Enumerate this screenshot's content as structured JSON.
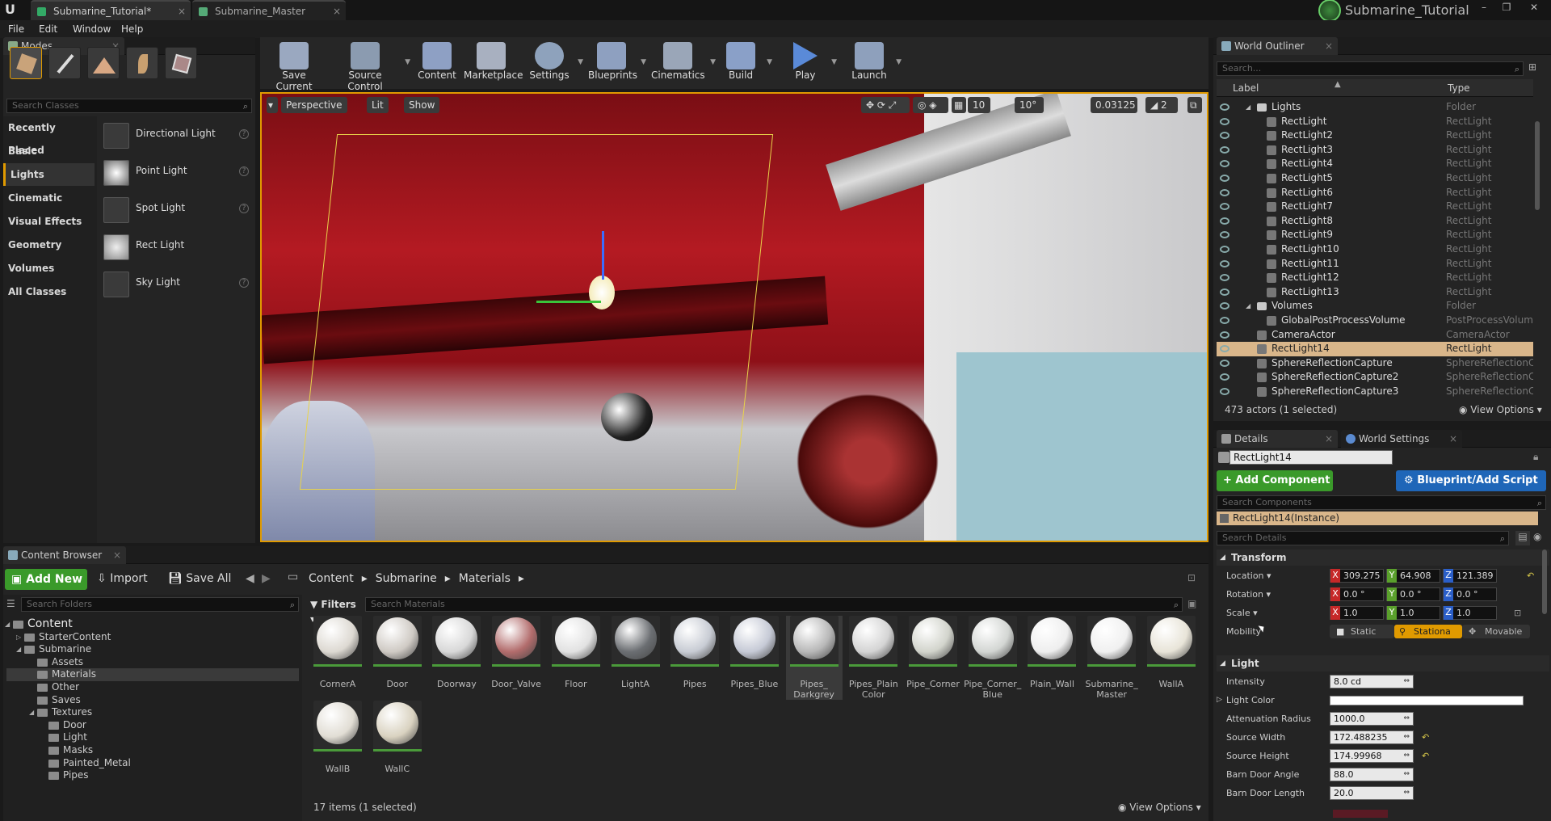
{
  "title_bar": {
    "tabs": [
      "Submarine_Tutorial*",
      "Submarine_Master"
    ],
    "project_name": "Submarine_Tutorial"
  },
  "menu": [
    "File",
    "Edit",
    "Window",
    "Help"
  ],
  "modes": {
    "tab_label": "Modes",
    "search_placeholder": "Search Classes",
    "categories": [
      "Recently Placed",
      "Basic",
      "Lights",
      "Cinematic",
      "Visual Effects",
      "Geometry",
      "Volumes",
      "All Classes"
    ],
    "selected_category": "Lights",
    "items": [
      "Directional Light",
      "Point Light",
      "Spot Light",
      "Rect Light",
      "Sky Light"
    ]
  },
  "toolbar": [
    "Save Current",
    "Source Control",
    "Content",
    "Marketplace",
    "Settings",
    "Blueprints",
    "Cinematics",
    "Build",
    "Play",
    "Launch"
  ],
  "viewport": {
    "view_mode": "Perspective",
    "lighting": "Lit",
    "show": "Show",
    "grid_snap": "10",
    "rot_snap": "10°",
    "scale_snap": "0.03125",
    "camera_speed": "2"
  },
  "outliner": {
    "tab_label": "World Outliner",
    "search_placeholder": "Search...",
    "col_label": "Label",
    "col_type": "Type",
    "rows": [
      {
        "name": "Lights",
        "type": "Folder",
        "indent": 1,
        "kind": "folder"
      },
      {
        "name": "RectLight",
        "type": "RectLight",
        "indent": 2,
        "kind": "light"
      },
      {
        "name": "RectLight2",
        "type": "RectLight",
        "indent": 2,
        "kind": "light"
      },
      {
        "name": "RectLight3",
        "type": "RectLight",
        "indent": 2,
        "kind": "light"
      },
      {
        "name": "RectLight4",
        "type": "RectLight",
        "indent": 2,
        "kind": "light"
      },
      {
        "name": "RectLight5",
        "type": "RectLight",
        "indent": 2,
        "kind": "light"
      },
      {
        "name": "RectLight6",
        "type": "RectLight",
        "indent": 2,
        "kind": "light"
      },
      {
        "name": "RectLight7",
        "type": "RectLight",
        "indent": 2,
        "kind": "light"
      },
      {
        "name": "RectLight8",
        "type": "RectLight",
        "indent": 2,
        "kind": "light"
      },
      {
        "name": "RectLight9",
        "type": "RectLight",
        "indent": 2,
        "kind": "light"
      },
      {
        "name": "RectLight10",
        "type": "RectLight",
        "indent": 2,
        "kind": "light"
      },
      {
        "name": "RectLight11",
        "type": "RectLight",
        "indent": 2,
        "kind": "light"
      },
      {
        "name": "RectLight12",
        "type": "RectLight",
        "indent": 2,
        "kind": "light"
      },
      {
        "name": "RectLight13",
        "type": "RectLight",
        "indent": 2,
        "kind": "light"
      },
      {
        "name": "Volumes",
        "type": "Folder",
        "indent": 1,
        "kind": "folder"
      },
      {
        "name": "GlobalPostProcessVolume",
        "type": "PostProcessVolume",
        "indent": 2,
        "kind": "volume"
      },
      {
        "name": "CameraActor",
        "type": "CameraActor",
        "indent": 1,
        "kind": "camera"
      },
      {
        "name": "RectLight14",
        "type": "RectLight",
        "indent": 1,
        "kind": "light",
        "selected": true
      },
      {
        "name": "SphereReflectionCapture",
        "type": "SphereReflectionCa",
        "indent": 1,
        "kind": "sphere"
      },
      {
        "name": "SphereReflectionCapture2",
        "type": "SphereReflectionCa",
        "indent": 1,
        "kind": "sphere"
      },
      {
        "name": "SphereReflectionCapture3",
        "type": "SphereReflectionCa",
        "indent": 1,
        "kind": "sphere"
      }
    ],
    "status": "473 actors (1 selected)",
    "view_options": "View Options"
  },
  "details": {
    "tab_details": "Details",
    "tab_world": "World Settings",
    "actor_name": "RectLight14",
    "add_component": "+ Add Component",
    "blueprint": "Blueprint/Add Script",
    "search_components": "Search Components",
    "instance": "RectLight14(Instance)",
    "search_details": "Search Details",
    "transform_header": "Transform",
    "location_label": "Location",
    "location": [
      "309.275",
      "64.908",
      "121.389"
    ],
    "rotation_label": "Rotation",
    "rotation": [
      "0.0 °",
      "0.0 °",
      "0.0 °"
    ],
    "scale_label": "Scale",
    "scale": [
      "1.0",
      "1.0",
      "1.0"
    ],
    "mobility_label": "Mobility",
    "mobility": [
      "Static",
      "Stationa",
      "Movable"
    ],
    "light_header": "Light",
    "intensity_label": "Intensity",
    "intensity": "8.0 cd",
    "light_color_label": "Light Color",
    "atten_label": "Attenuation Radius",
    "atten": "1000.0",
    "source_width_label": "Source Width",
    "source_width": "172.488235",
    "source_height_label": "Source Height",
    "source_height": "174.99968",
    "barn_angle_label": "Barn Door Angle",
    "barn_angle": "88.0",
    "barn_length_label": "Barn Door Length",
    "barn_length": "20.0"
  },
  "content_browser": {
    "tab_label": "Content Browser",
    "add_new": "Add New",
    "import": "Import",
    "save_all": "Save All",
    "path": [
      "Content",
      "Submarine",
      "Materials"
    ],
    "search_folders": "Search Folders",
    "filters": "Filters",
    "search_materials": "Search Materials",
    "folders": [
      {
        "name": "Content",
        "indent": 0
      },
      {
        "name": "StarterContent",
        "indent": 1
      },
      {
        "name": "Submarine",
        "indent": 1
      },
      {
        "name": "Assets",
        "indent": 2
      },
      {
        "name": "Materials",
        "indent": 2,
        "selected": true
      },
      {
        "name": "Other",
        "indent": 2
      },
      {
        "name": "Saves",
        "indent": 2
      },
      {
        "name": "Textures",
        "indent": 2
      },
      {
        "name": "Door",
        "indent": 3
      },
      {
        "name": "Light",
        "indent": 3
      },
      {
        "name": "Masks",
        "indent": 3
      },
      {
        "name": "Painted_Metal",
        "indent": 3
      },
      {
        "name": "Pipes",
        "indent": 3
      }
    ],
    "assets": [
      {
        "name": "CornerA",
        "color": "#ddd9d2"
      },
      {
        "name": "Door",
        "color": "#cfcac4"
      },
      {
        "name": "Doorway",
        "color": "#d8d8d8"
      },
      {
        "name": "Door_Valve",
        "color": "#b26c6c"
      },
      {
        "name": "Floor",
        "color": "#e2e2e2"
      },
      {
        "name": "LightA",
        "color": "#6b6e72"
      },
      {
        "name": "Pipes",
        "color": "#c8ccd4"
      },
      {
        "name": "Pipes_Blue",
        "color": "#c6cad6"
      },
      {
        "name": "Pipes_\nDarkgrey",
        "color": "#b8b8b8",
        "selected": true
      },
      {
        "name": "Pipes_Plain\nColor",
        "color": "#d4d4d4"
      },
      {
        "name": "Pipe_Corner",
        "color": "#d2d4cc"
      },
      {
        "name": "Pipe_Corner_\nBlue",
        "color": "#d3d6d3"
      },
      {
        "name": "Plain_Wall",
        "color": "#eeeeee"
      },
      {
        "name": "Submarine_\nMaster",
        "color": "#f0f0f0"
      },
      {
        "name": "WallA",
        "color": "#e8e4d8"
      },
      {
        "name": "WallB",
        "color": "#e1ddd4"
      },
      {
        "name": "WallC",
        "color": "#d9d2c0"
      }
    ],
    "status": "17 items (1 selected)",
    "view_options": "View Options"
  }
}
